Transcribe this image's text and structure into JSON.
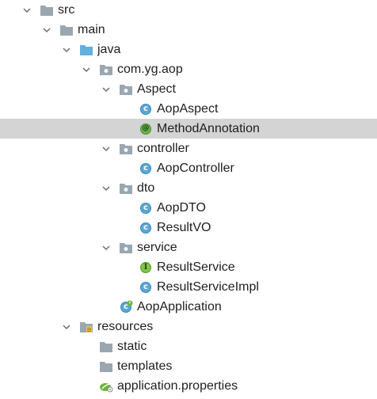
{
  "tree": [
    {
      "label": "src",
      "icon": "folder-icon",
      "expand": "expanded",
      "level": 0,
      "selected": false
    },
    {
      "label": "main",
      "icon": "folder-icon",
      "expand": "expanded",
      "level": 1,
      "selected": false
    },
    {
      "label": "java",
      "icon": "source-folder-icon",
      "expand": "expanded",
      "level": 2,
      "selected": false
    },
    {
      "label": "com.yg.aop",
      "icon": "package-icon",
      "expand": "expanded",
      "level": 3,
      "selected": false
    },
    {
      "label": "Aspect",
      "icon": "package-icon",
      "expand": "expanded",
      "level": 4,
      "selected": false
    },
    {
      "label": "AopAspect",
      "icon": "class-icon",
      "expand": "none",
      "level": 5,
      "selected": false
    },
    {
      "label": "MethodAnnotation",
      "icon": "annotation-icon",
      "expand": "none",
      "level": 5,
      "selected": true
    },
    {
      "label": "controller",
      "icon": "package-icon",
      "expand": "expanded",
      "level": 4,
      "selected": false
    },
    {
      "label": "AopController",
      "icon": "class-icon",
      "expand": "none",
      "level": 5,
      "selected": false
    },
    {
      "label": "dto",
      "icon": "package-icon",
      "expand": "expanded",
      "level": 4,
      "selected": false
    },
    {
      "label": "AopDTO",
      "icon": "class-icon",
      "expand": "none",
      "level": 5,
      "selected": false
    },
    {
      "label": "ResultVO",
      "icon": "class-icon",
      "expand": "none",
      "level": 5,
      "selected": false
    },
    {
      "label": "service",
      "icon": "package-icon",
      "expand": "expanded",
      "level": 4,
      "selected": false
    },
    {
      "label": "ResultService",
      "icon": "interface-icon",
      "expand": "none",
      "level": 5,
      "selected": false
    },
    {
      "label": "ResultServiceImpl",
      "icon": "class-icon",
      "expand": "none",
      "level": 5,
      "selected": false
    },
    {
      "label": "AopApplication",
      "icon": "spring-boot-class-icon",
      "expand": "none",
      "level": 4,
      "selected": false
    },
    {
      "label": "resources",
      "icon": "resources-folder-icon",
      "expand": "expanded",
      "level": 2,
      "selected": false
    },
    {
      "label": "static",
      "icon": "folder-icon",
      "expand": "none",
      "level": 3,
      "selected": false
    },
    {
      "label": "templates",
      "icon": "folder-icon",
      "expand": "none",
      "level": 3,
      "selected": false
    },
    {
      "label": "application.properties",
      "icon": "spring-properties-icon",
      "expand": "none",
      "level": 3,
      "selected": false
    }
  ],
  "colors": {
    "selection": "#d4d4d4",
    "folder": "#9aa7b0",
    "source_folder": "#62b0de",
    "class_badge": "#59a8d4",
    "annotation_badge": "#6ab04c",
    "interface_badge": "#7ec34a"
  }
}
